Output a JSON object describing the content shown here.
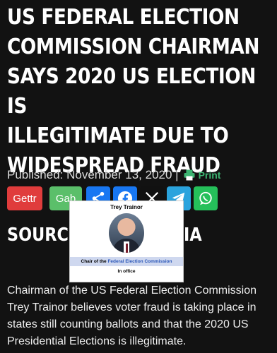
{
  "headline": "US FEDERAL ELECTION\nCOMMISSION CHAIRMAN\nSAYS 2020 US ELECTION IS\nILLEGITIMATE DUE TO\nWIDESPREAD FRAUD",
  "meta": {
    "published": "Published: November 13, 2020 |",
    "print_label": "Print"
  },
  "share": {
    "gettr": "Gettr",
    "gab": "Gab"
  },
  "source": {
    "label": "SOURCE:",
    "tail": "IA"
  },
  "infobox": {
    "name": "Trey Trainor",
    "role_prefix": "Chair of the ",
    "role_link": "Federal Election Commission",
    "status": "In office"
  },
  "body": "Chairman of the US Federal Election Commission Trey Trainor believes voter fraud is taking place in states still counting ballots and that the 2020 US Presidential Elections is illegitimate.",
  "colors": {
    "gettr": "#e03c3c",
    "gab": "#5bbf6a",
    "facebook": "#1877f2",
    "twitter": "#111111",
    "telegram": "#2aa3dd",
    "whatsapp": "#25c05a"
  }
}
